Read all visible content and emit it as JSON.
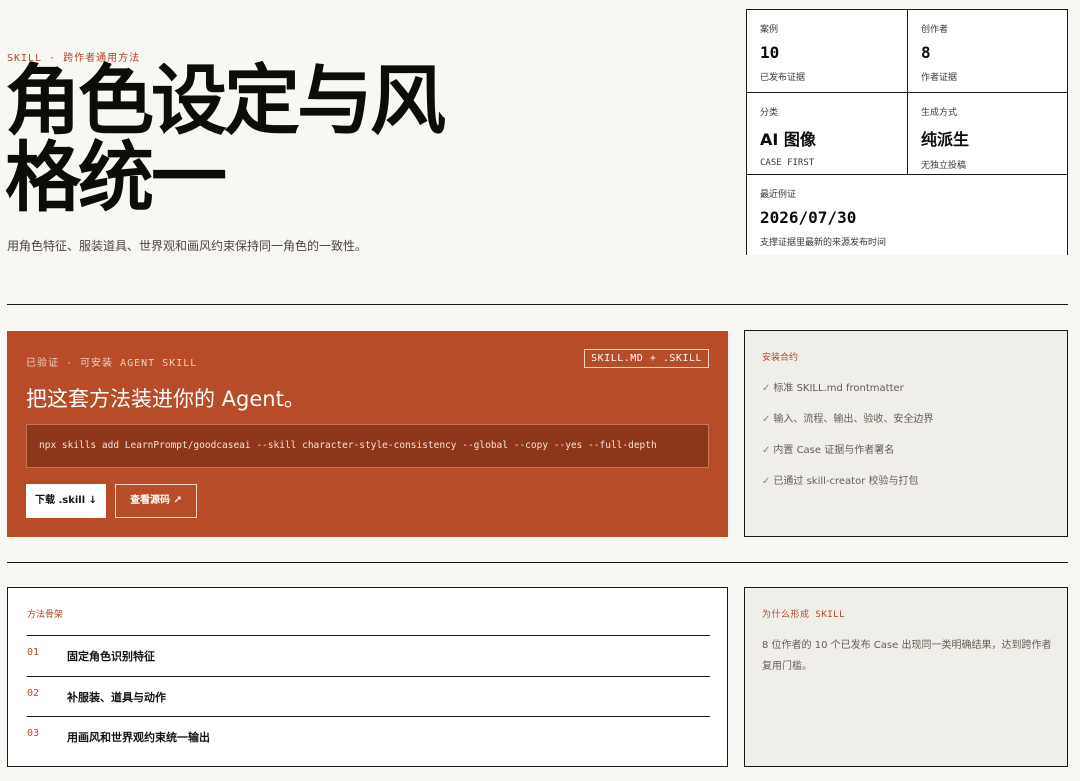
{
  "hero": {
    "eyebrow": "SKILL · 跨作者通用方法",
    "title": "角色设定与风格统一",
    "description": "用角色特征、服装道具、世界观和画风约束保持同一角色的一致性。"
  },
  "stats": [
    {
      "label": "案例",
      "value": "10",
      "sub": "已发布证据"
    },
    {
      "label": "创作者",
      "value": "8",
      "sub": "作者证据"
    },
    {
      "label": "分类",
      "value": "AI 图像",
      "sub": "CASE FIRST"
    },
    {
      "label": "生成方式",
      "value": "纯派生",
      "sub": "无独立投稿"
    },
    {
      "label": "最近例证",
      "value": "2026/07/30",
      "sub": "支撑证据里最新的来源发布时间"
    }
  ],
  "install": {
    "badge": "已验证 · 可安装 AGENT SKILL",
    "file_tag": "SKILL.MD + .SKILL",
    "headline": "把这套方法装进你的 Agent。",
    "command": "npx skills add LearnPrompt/goodcaseai --skill character-style-consistency --global --copy --yes --full-depth",
    "download_label": "下载 .skill ↓",
    "source_label": "查看源码 ↗"
  },
  "contract": {
    "title": "安装合约",
    "check_glyph": "✓",
    "items": [
      "标准 SKILL.md frontmatter",
      "输入、流程、输出、验收、安全边界",
      "内置 Case 证据与作者署名",
      "已通过 skill-creator 校验与打包"
    ]
  },
  "method": {
    "title": "方法骨架",
    "steps": [
      {
        "num": "01",
        "label": "固定角色识别特征"
      },
      {
        "num": "02",
        "label": "补服装、道具与动作"
      },
      {
        "num": "03",
        "label": "用画风和世界观约束统一输出"
      }
    ]
  },
  "why": {
    "title": "为什么形成 SKILL",
    "text": "8 位作者的 10 个已发布 Case 出现同一类明确结果，达到跨作者复用门槛。"
  },
  "colors": {
    "accent": "#b84b28",
    "background": "#f8f7f3",
    "panel": "#f0eee8",
    "ink": "#161412"
  }
}
